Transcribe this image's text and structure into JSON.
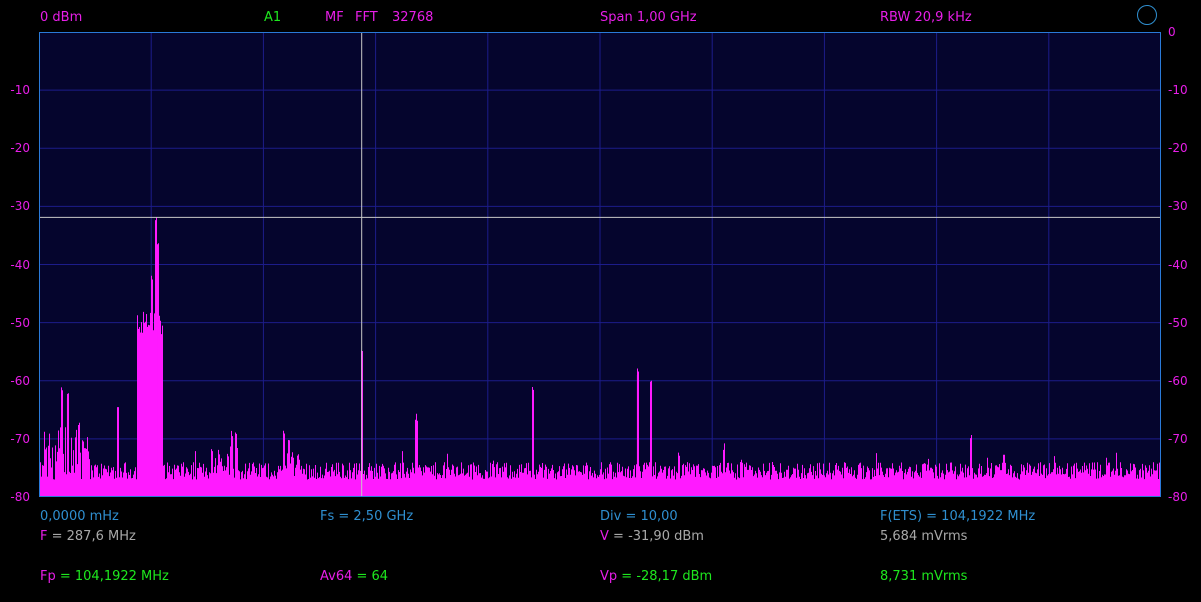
{
  "header": {
    "reference_level": "0 dBm",
    "channel": "A1",
    "mode": "MF",
    "fft_label": "FFT",
    "fft_size": "32768",
    "span": "Span 1,00 GHz",
    "rbw": "RBW 20,9 kHz"
  },
  "axis": {
    "y_ticks_left": [
      "-10",
      "-20",
      "-30",
      "-40",
      "-50",
      "-60",
      "-70",
      "-80"
    ],
    "y_ticks_right": [
      "0",
      "-10",
      "-20",
      "-30",
      "-40",
      "-50",
      "-60",
      "-70",
      "-80"
    ]
  },
  "footer": {
    "start_freq": "0,0000 mHz",
    "fs": "Fs = 2,50 GHz",
    "div": "Div = 10,00",
    "f_ets": "F(ETS) = 104,1922 MHz",
    "cursor_f_label": "F",
    "cursor_f_value": " = 287,6 MHz",
    "cursor_v_label": "V",
    "cursor_v_value": " = -31,90 dBm",
    "cursor_vrms": "5,684 mVrms",
    "peak_f_label": "Fp",
    "peak_f_value": " = 104,1922 MHz",
    "average_label": "Av64",
    "average_value": " = 64",
    "peak_v_label": "Vp",
    "peak_v_value": " = -28,17 dBm",
    "peak_vrms": "8,731 mVrms"
  },
  "colors": {
    "trace": "#ff1aff",
    "plot_bg": "#05052d",
    "grid": "#1c1c8a",
    "frame": "#2a7ad8",
    "cursor": "#c8c8c8"
  },
  "chart_data": {
    "type": "line",
    "xlabel": "",
    "ylabel": "",
    "xlim_mhz": [
      0,
      1000
    ],
    "ylim_dbm": [
      -80,
      0
    ],
    "grid": true,
    "cursor": {
      "frequency_mhz": 287.6,
      "level_dbm": -31.9
    },
    "noise_floor_dbm": -78,
    "peaks": [
      {
        "freq_mhz": 20,
        "dbm": -62
      },
      {
        "freq_mhz": 25,
        "dbm": -63
      },
      {
        "freq_mhz": 35,
        "dbm": -68
      },
      {
        "freq_mhz": 70,
        "dbm": -66
      },
      {
        "freq_mhz": 92,
        "dbm": -63
      },
      {
        "freq_mhz": 95,
        "dbm": -50
      },
      {
        "freq_mhz": 100,
        "dbm": -43
      },
      {
        "freq_mhz": 104.2,
        "dbm": -33
      },
      {
        "freq_mhz": 106,
        "dbm": -37
      },
      {
        "freq_mhz": 160,
        "dbm": -73
      },
      {
        "freq_mhz": 172,
        "dbm": -70
      },
      {
        "freq_mhz": 175,
        "dbm": -70
      },
      {
        "freq_mhz": 218,
        "dbm": -70
      },
      {
        "freq_mhz": 222,
        "dbm": -71
      },
      {
        "freq_mhz": 287.6,
        "dbm": -55
      },
      {
        "freq_mhz": 336,
        "dbm": -67
      },
      {
        "freq_mhz": 440,
        "dbm": -62
      },
      {
        "freq_mhz": 533,
        "dbm": -59
      },
      {
        "freq_mhz": 545,
        "dbm": -61
      },
      {
        "freq_mhz": 570,
        "dbm": -73
      },
      {
        "freq_mhz": 610,
        "dbm": -72
      },
      {
        "freq_mhz": 625,
        "dbm": -74
      },
      {
        "freq_mhz": 830,
        "dbm": -70
      },
      {
        "freq_mhz": 860,
        "dbm": -73
      }
    ]
  }
}
